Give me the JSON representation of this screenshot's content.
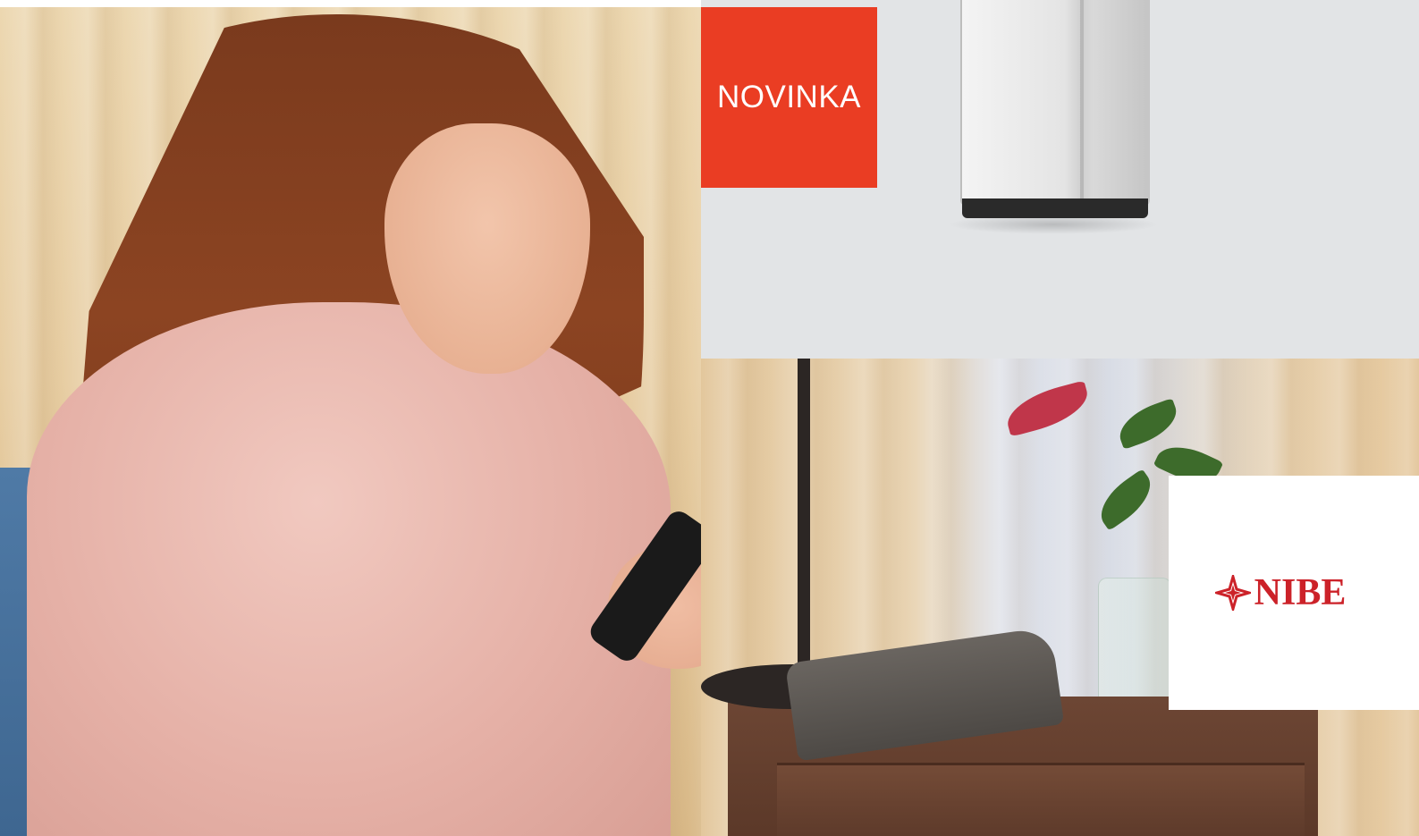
{
  "promo": {
    "badge_label": "NOVINKA",
    "brand_name": "NIBE"
  },
  "colors": {
    "badge": "#ea3d23",
    "brand": "#cc2229",
    "product_background": "#e2e4e6"
  },
  "images": {
    "left_photo": "woman-with-phone-photo",
    "top_right_photo": "heat-pump-product-photo",
    "bottom_right_photo": "side-table-with-telephone-photo"
  }
}
